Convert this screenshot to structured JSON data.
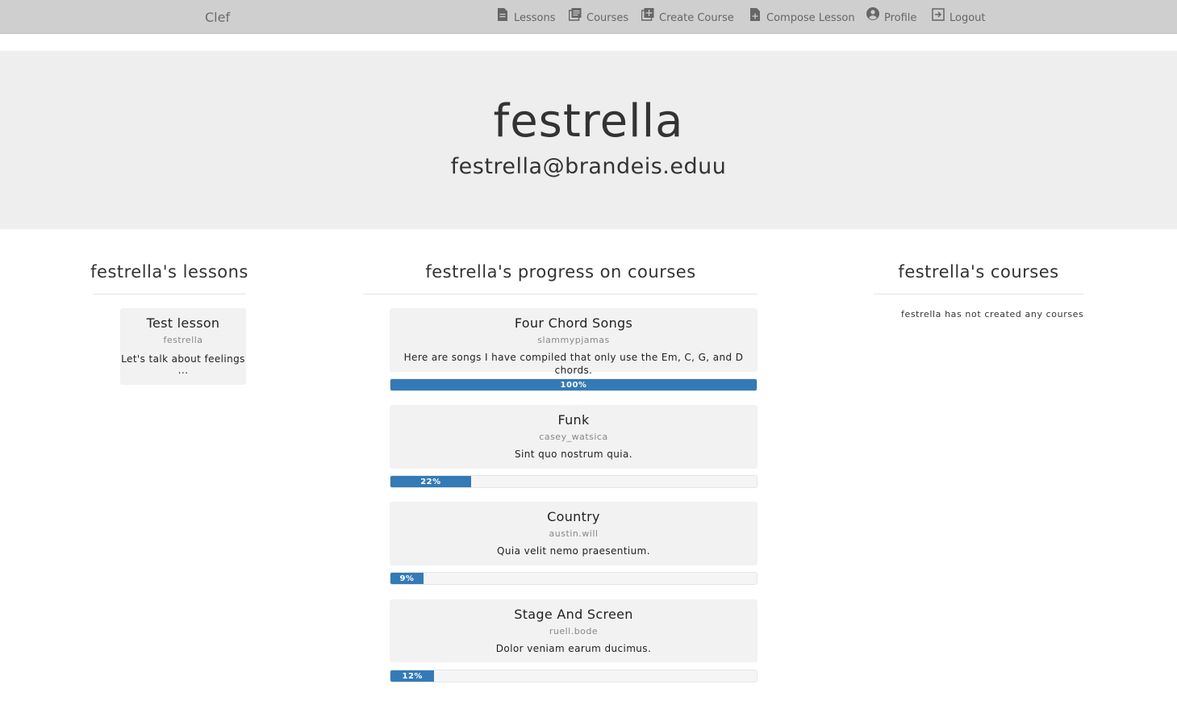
{
  "nav": {
    "brand": "Clef",
    "items": [
      {
        "label": "Lessons",
        "icon": "document-icon"
      },
      {
        "label": "Courses",
        "icon": "library-icon"
      },
      {
        "label": "Create Course",
        "icon": "add-box-icon"
      },
      {
        "label": "Compose Lesson",
        "icon": "note-add-icon"
      },
      {
        "label": "Profile",
        "icon": "account-circle-icon"
      },
      {
        "label": "Logout",
        "icon": "exit-icon"
      }
    ]
  },
  "profile": {
    "username": "festrella",
    "email": "festrella@brandeis.eduu"
  },
  "lessons": {
    "title": "festrella's lessons",
    "items": [
      {
        "title": "Test lesson",
        "author": "festrella",
        "description": "Let's talk about feelings",
        "more": "..."
      }
    ]
  },
  "progress": {
    "title": "festrella's progress on courses",
    "items": [
      {
        "title": "Four Chord Songs",
        "author": "slammypjamas",
        "description": "Here are songs I have compiled that only use the Em, C, G, and D chords.",
        "percent": 100,
        "percent_label": "100%"
      },
      {
        "title": "Funk",
        "author": "casey_watsica",
        "description": "Sint quo nostrum quia.",
        "percent": 22,
        "percent_label": "22%"
      },
      {
        "title": "Country",
        "author": "austin.will",
        "description": "Quia velit nemo praesentium.",
        "percent": 9,
        "percent_label": "9%"
      },
      {
        "title": "Stage And Screen",
        "author": "ruell.bode",
        "description": "Dolor veniam earum ducimus.",
        "percent": 12,
        "percent_label": "12%"
      }
    ]
  },
  "courses": {
    "title": "festrella's courses",
    "empty_message": "festrella has not created any courses"
  },
  "colors": {
    "navbar": "#cfcfcf",
    "jumbotron": "#eeeeee",
    "card": "#f2f2f2",
    "progress_fill": "#337ab7"
  }
}
